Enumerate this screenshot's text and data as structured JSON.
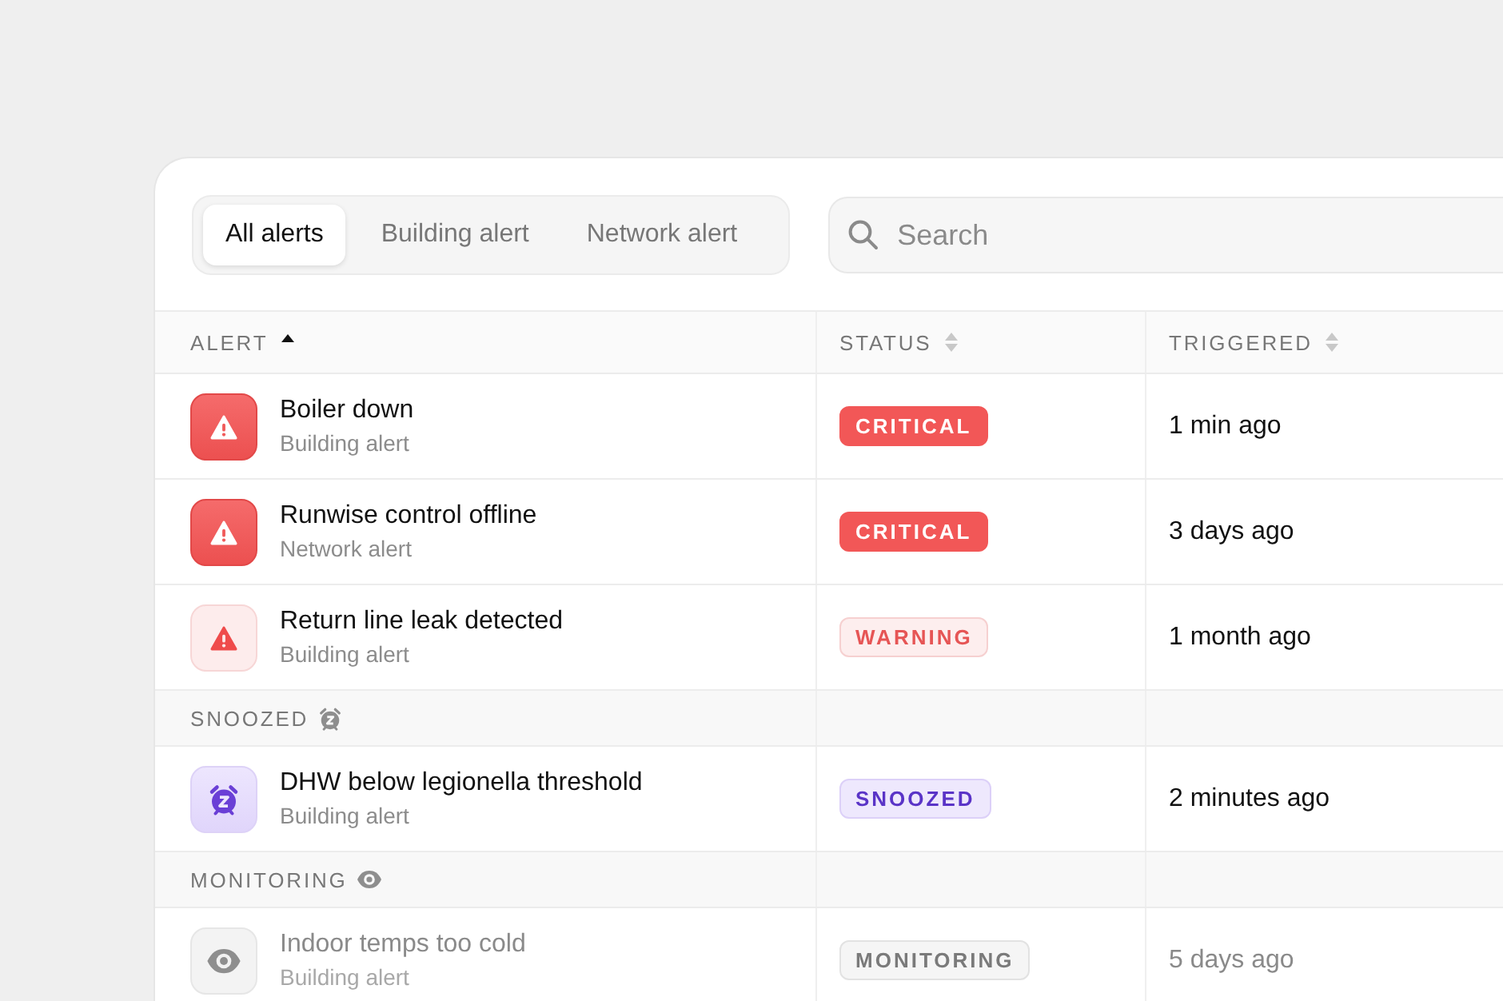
{
  "tabs": [
    {
      "label": "All alerts",
      "selected": true
    },
    {
      "label": "Building alert",
      "selected": false
    },
    {
      "label": "Network alert",
      "selected": false
    }
  ],
  "search": {
    "placeholder": "Search"
  },
  "table": {
    "columns": [
      {
        "label": "ALERT",
        "sorted": true
      },
      {
        "label": "STATUS",
        "sorted": false
      },
      {
        "label": "TRIGGERED",
        "sorted": false
      }
    ],
    "rows": [
      {
        "kind": "critical",
        "title": "Boiler down",
        "subtitle": "Building alert",
        "status": "CRITICAL",
        "triggered": "1 min ago"
      },
      {
        "kind": "critical",
        "title": "Runwise control offline",
        "subtitle": "Network alert",
        "status": "CRITICAL",
        "triggered": "3 days ago"
      },
      {
        "kind": "warning",
        "title": "Return line leak detected",
        "subtitle": "Building alert",
        "status": "WARNING",
        "triggered": "1 month ago"
      }
    ],
    "groups": [
      {
        "kind": "snoozed",
        "label": "SNOOZED",
        "rows": [
          {
            "kind": "snoozed",
            "title": "DHW below legionella threshold",
            "subtitle": "Building alert",
            "status": "SNOOZED",
            "triggered": "2 minutes ago"
          }
        ]
      },
      {
        "kind": "monitoring",
        "label": "MONITORING",
        "rows": [
          {
            "kind": "monitoring",
            "title": "Indoor temps too cold",
            "subtitle": "Building alert",
            "status": "MONITORING",
            "triggered": "5 days ago"
          }
        ]
      }
    ]
  }
}
